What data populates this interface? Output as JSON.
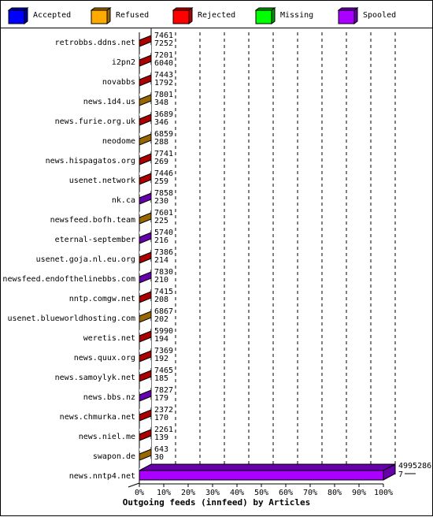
{
  "legend": [
    {
      "label": "Accepted",
      "color": "#0000ff",
      "side": "#000099"
    },
    {
      "label": "Refused",
      "color": "#ffaa00",
      "side": "#996600"
    },
    {
      "label": "Rejected",
      "color": "#ff0000",
      "side": "#aa0000"
    },
    {
      "label": "Missing",
      "color": "#00ff00",
      "side": "#009900"
    },
    {
      "label": "Spooled",
      "color": "#aa00ff",
      "side": "#6600aa"
    }
  ],
  "chart_data": {
    "type": "bar",
    "orientation": "horizontal",
    "stacked": true,
    "percent": true,
    "title": "Outgoing feeds (innfeed) by Articles",
    "xlabel": "Outgoing feeds (innfeed) by Articles",
    "ylabel": "",
    "xlim": [
      0,
      100
    ],
    "x_ticks": [
      "0%",
      "10%",
      "20%",
      "30%",
      "40%",
      "50%",
      "60%",
      "70%",
      "80%",
      "90%",
      "100%"
    ],
    "grid": true,
    "legend_position": "top",
    "series_names": [
      "Accepted",
      "Refused",
      "Rejected",
      "Missing",
      "Spooled"
    ],
    "categories": [
      {
        "name": "retrobbs.ddns.net",
        "labels": [
          "7461",
          "7252"
        ],
        "dominant": "Rejected"
      },
      {
        "name": "i2pn2",
        "labels": [
          "7201",
          "6040"
        ],
        "dominant": "Rejected"
      },
      {
        "name": "novabbs",
        "labels": [
          "7443",
          "1792"
        ],
        "dominant": "Rejected"
      },
      {
        "name": "news.1d4.us",
        "labels": [
          "7801",
          "348"
        ],
        "dominant": "Refused"
      },
      {
        "name": "news.furie.org.uk",
        "labels": [
          "3689",
          "346"
        ],
        "dominant": "Rejected"
      },
      {
        "name": "neodome",
        "labels": [
          "6859",
          "288"
        ],
        "dominant": "Refused"
      },
      {
        "name": "news.hispagatos.org",
        "labels": [
          "7741",
          "269"
        ],
        "dominant": "Rejected"
      },
      {
        "name": "usenet.network",
        "labels": [
          "7446",
          "259"
        ],
        "dominant": "Rejected"
      },
      {
        "name": "nk.ca",
        "labels": [
          "7858",
          "230"
        ],
        "dominant": "Spooled"
      },
      {
        "name": "newsfeed.bofh.team",
        "labels": [
          "7601",
          "225"
        ],
        "dominant": "Refused"
      },
      {
        "name": "eternal-september",
        "labels": [
          "5740",
          "216"
        ],
        "dominant": "Spooled"
      },
      {
        "name": "usenet.goja.nl.eu.org",
        "labels": [
          "7386",
          "214"
        ],
        "dominant": "Rejected"
      },
      {
        "name": "newsfeed.endofthelinebbs.com",
        "labels": [
          "7830",
          "210"
        ],
        "dominant": "Spooled"
      },
      {
        "name": "nntp.comgw.net",
        "labels": [
          "7415",
          "208"
        ],
        "dominant": "Rejected"
      },
      {
        "name": "usenet.blueworldhosting.com",
        "labels": [
          "6867",
          "202"
        ],
        "dominant": "Refused"
      },
      {
        "name": "weretis.net",
        "labels": [
          "5990",
          "194"
        ],
        "dominant": "Rejected"
      },
      {
        "name": "news.quux.org",
        "labels": [
          "7369",
          "192"
        ],
        "dominant": "Rejected"
      },
      {
        "name": "news.samoylyk.net",
        "labels": [
          "7465",
          "185"
        ],
        "dominant": "Rejected"
      },
      {
        "name": "news.bbs.nz",
        "labels": [
          "7827",
          "179"
        ],
        "dominant": "Spooled"
      },
      {
        "name": "news.chmurka.net",
        "labels": [
          "2372",
          "170"
        ],
        "dominant": "Rejected"
      },
      {
        "name": "news.niel.me",
        "labels": [
          "2261",
          "139"
        ],
        "dominant": "Rejected"
      },
      {
        "name": "swapon.de",
        "labels": [
          "643",
          "30"
        ],
        "dominant": "Refused"
      },
      {
        "name": "news.nntp4.net",
        "labels": [
          "4995286",
          "7"
        ],
        "dominant": "Spooled",
        "value_percent": 100
      }
    ]
  }
}
